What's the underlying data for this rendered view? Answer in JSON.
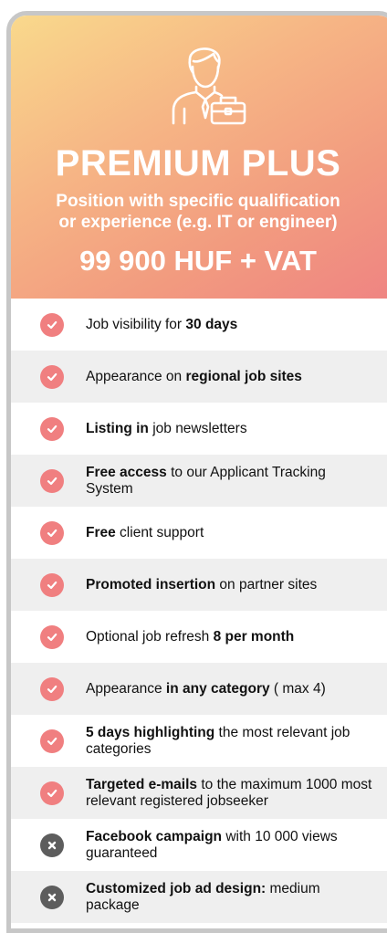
{
  "plan": {
    "title": "PREMIUM PLUS",
    "subtitle_line1": "Position with specific qualification",
    "subtitle_line2": "or experience (e.g. IT or engineer)",
    "price": "99 900 HUF + VAT",
    "header_icon": "businessman-briefcase-icon"
  },
  "colors": {
    "included_badge": "#f07f80",
    "excluded_badge": "#5d5d5d",
    "alt_row": "#efefef",
    "card_border": "#c7c7c7"
  },
  "features": [
    {
      "included": true,
      "parts": [
        {
          "t": "Job visibility for ",
          "b": false
        },
        {
          "t": "30 days",
          "b": true
        }
      ]
    },
    {
      "included": true,
      "parts": [
        {
          "t": "Appearance on ",
          "b": false
        },
        {
          "t": "regional job sites",
          "b": true
        }
      ]
    },
    {
      "included": true,
      "parts": [
        {
          "t": "Listing in",
          "b": true
        },
        {
          "t": " job newsletters",
          "b": false
        }
      ]
    },
    {
      "included": true,
      "parts": [
        {
          "t": "Free access",
          "b": true
        },
        {
          "t": " to our Applicant Tracking System",
          "b": false
        }
      ]
    },
    {
      "included": true,
      "parts": [
        {
          "t": "Free",
          "b": true
        },
        {
          "t": " client support",
          "b": false
        }
      ]
    },
    {
      "included": true,
      "parts": [
        {
          "t": "Promoted insertion",
          "b": true
        },
        {
          "t": " on partner sites",
          "b": false
        }
      ]
    },
    {
      "included": true,
      "parts": [
        {
          "t": "Optional job refresh ",
          "b": false
        },
        {
          "t": "8 per month",
          "b": true
        }
      ]
    },
    {
      "included": true,
      "parts": [
        {
          "t": "Appearance ",
          "b": false
        },
        {
          "t": "in any category",
          "b": true
        },
        {
          "t": " ( max 4)",
          "b": false
        }
      ]
    },
    {
      "included": true,
      "parts": [
        {
          "t": "5 days highlighting",
          "b": true
        },
        {
          "t": " the most relevant job categories",
          "b": false
        }
      ]
    },
    {
      "included": true,
      "parts": [
        {
          "t": "Targeted e-mails",
          "b": true
        },
        {
          "t": " to the maximum 1000 most relevant registered jobseeker",
          "b": false
        }
      ]
    },
    {
      "included": false,
      "parts": [
        {
          "t": "Facebook campaign",
          "b": true
        },
        {
          "t": " with 10 000 views guaranteed",
          "b": false
        }
      ]
    },
    {
      "included": false,
      "parts": [
        {
          "t": "Customized job ad design:",
          "b": true
        },
        {
          "t": " medium package",
          "b": false
        }
      ]
    }
  ]
}
